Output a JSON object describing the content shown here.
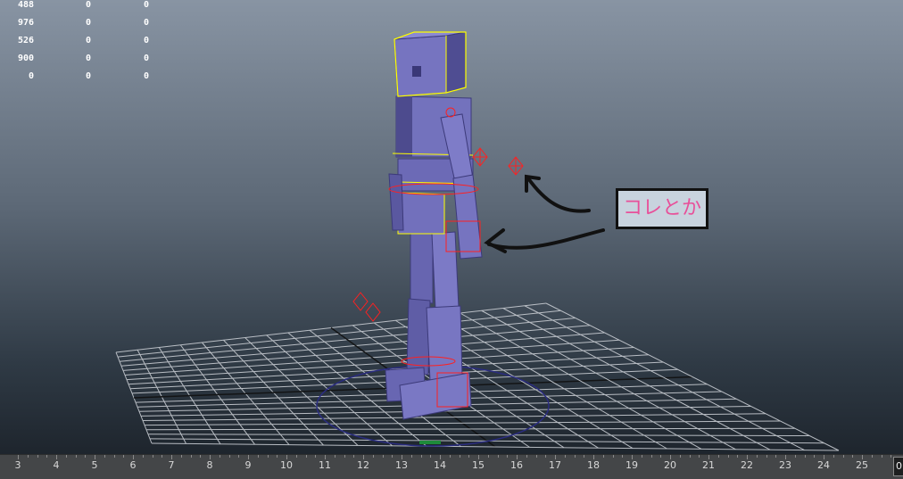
{
  "stats": {
    "rows": [
      [
        "488",
        "0",
        "0"
      ],
      [
        "976",
        "0",
        "0"
      ],
      [
        "526",
        "0",
        "0"
      ],
      [
        "900",
        "0",
        "0"
      ],
      [
        "0",
        "0",
        "0"
      ]
    ]
  },
  "annotation": {
    "text": "コレとか"
  },
  "timeline": {
    "ticks": [
      "3",
      "4",
      "5",
      "6",
      "7",
      "8",
      "9",
      "10",
      "11",
      "12",
      "13",
      "14",
      "15",
      "16",
      "17",
      "18",
      "19",
      "20",
      "21",
      "22",
      "23",
      "24",
      "25"
    ],
    "current_frame": "0"
  },
  "colors": {
    "mesh": "#7a78c4",
    "mesh_dark": "#4d4b8e",
    "selection": "#ffff00",
    "joint": "#ff2020",
    "grid": "#c8ccd2"
  }
}
